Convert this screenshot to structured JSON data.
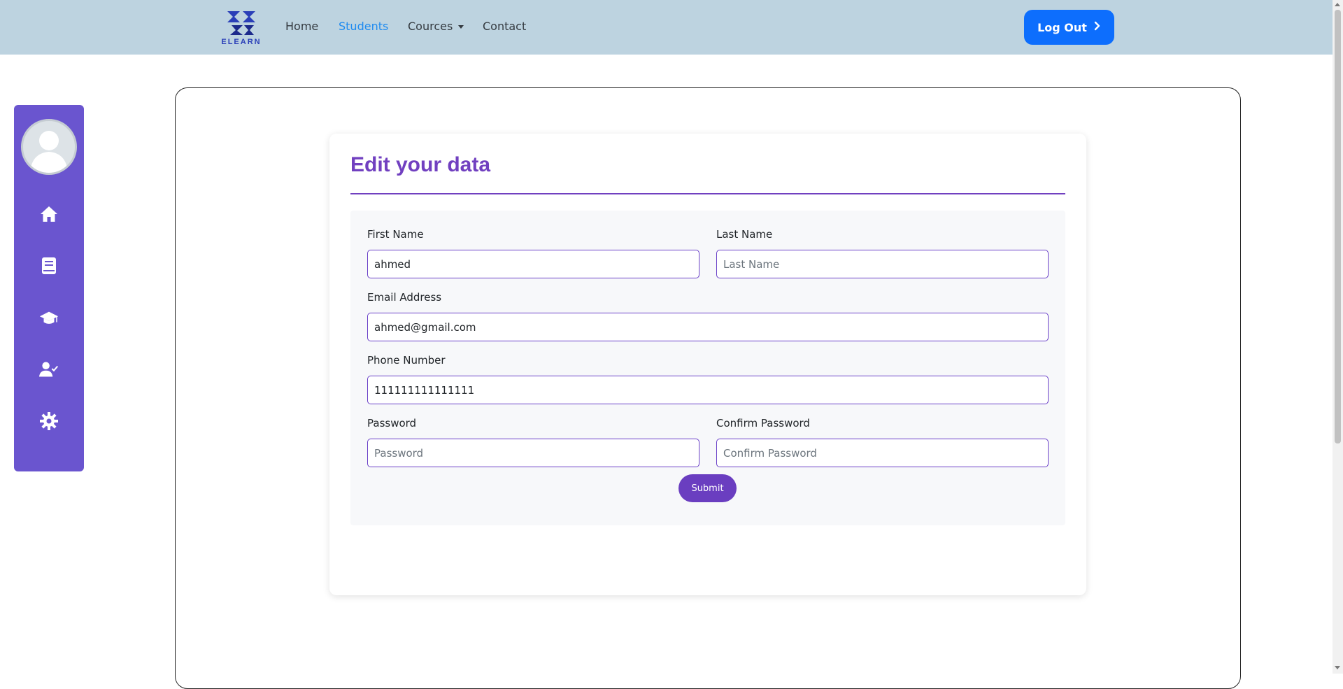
{
  "navbar": {
    "logo_text": "ELEARN",
    "links": [
      "Home",
      "Students",
      "Cources",
      "Contact"
    ],
    "active": "Students",
    "logout_label": "Log Out"
  },
  "sidebar": {
    "icons": [
      "home-icon",
      "book-icon",
      "graduation-cap-icon",
      "user-check-icon",
      "gear-icon"
    ]
  },
  "form": {
    "title": "Edit your data",
    "first_name": {
      "label": "First Name",
      "value": "ahmed",
      "placeholder": "First Name"
    },
    "last_name": {
      "label": "Last Name",
      "value": "",
      "placeholder": "Last Name"
    },
    "email": {
      "label": "Email Address",
      "value": "ahmed@gmail.com",
      "placeholder": "Email Address"
    },
    "phone": {
      "label": "Phone Number",
      "value": "111111111111111",
      "placeholder": "Phone Number"
    },
    "password": {
      "label": "Password",
      "value": "",
      "placeholder": "Password"
    },
    "confirm_password": {
      "label": "Confirm Password",
      "value": "",
      "placeholder": "Confirm Password"
    },
    "submit_label": "Submit"
  },
  "colors": {
    "navbar_bg": "#bdd3e0",
    "sidebar_bg": "#6a55cf",
    "accent_purple": "#7140c0",
    "logout_blue": "#0d6efd",
    "active_link": "#1f8bf0"
  }
}
